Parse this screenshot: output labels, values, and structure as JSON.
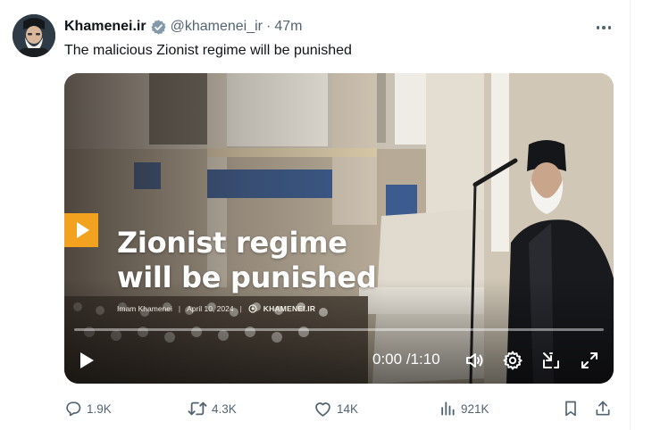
{
  "tweet": {
    "author": {
      "name": "Khamenei.ir",
      "handle": "@khamenei_ir",
      "verified_icon": "verified-badge-icon",
      "avatar_icon": "avatar"
    },
    "separator": "·",
    "time_ago": "47m",
    "text": "The malicious Zionist regime will be punished",
    "more_icon": "more-options-icon"
  },
  "video": {
    "overlay_title_line1": "Zionist regime",
    "overlay_title_line2": "will be punished",
    "meta": {
      "speaker": "Imam Khamenei",
      "sep": "|",
      "date": "April 10, 2024",
      "brand": "KHAMENEI.IR"
    },
    "progress": 0.0,
    "current_time": "0:00",
    "time_sep": "/",
    "duration": "1:10",
    "controls": [
      "play-icon",
      "volume-icon",
      "settings-gear-icon",
      "pop-out-icon",
      "fullscreen-icon"
    ],
    "badge_color": "#f3a21f"
  },
  "actions": {
    "replies": "1.9K",
    "retweets": "4.3K",
    "likes": "14K",
    "views": "921K",
    "bookmark_icon": "bookmark-icon",
    "share_icon": "share-icon"
  },
  "colors": {
    "text": "#0f1419",
    "secondary": "#536471",
    "verified": "#829aab"
  }
}
